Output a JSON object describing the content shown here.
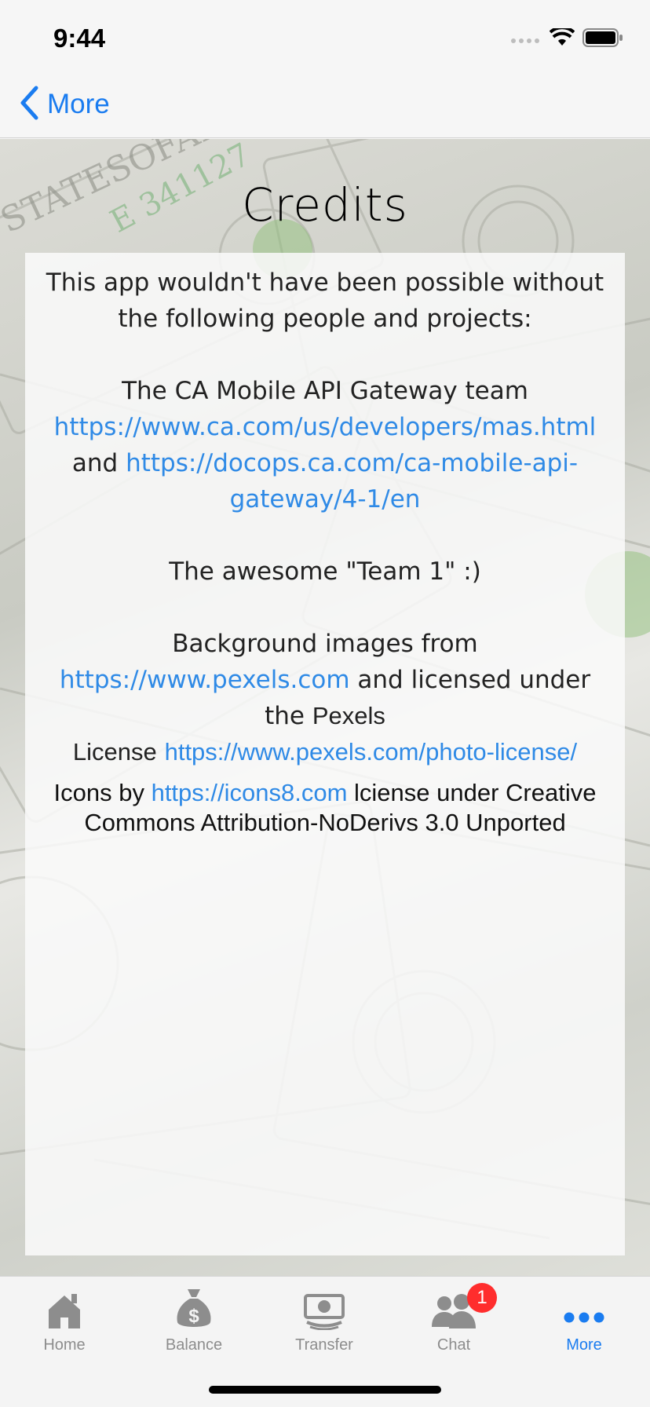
{
  "status_bar": {
    "time": "9:44"
  },
  "nav": {
    "back_label": "More"
  },
  "page": {
    "title": "Credits"
  },
  "credits": {
    "intro": "This app wouldn't have been possible without the following people and projects:",
    "gateway_prefix": "The CA Mobile API Gateway team ",
    "gateway_link1": "https://www.ca.com/us/developers/mas.html",
    "gateway_and": " and ",
    "gateway_link2": "https://docops.ca.com/ca-mobile-api-gateway/4-1/en",
    "team": "The awesome \"Team 1\" :)",
    "bg_prefix": "Background images from ",
    "bg_link": "https://www.pexels.com",
    "bg_middle": " and licensed under the ",
    "bg_pexels": "Pexels",
    "bg_license": "License",
    "bg_license_link": "https://www.pexels.com/photo-license/",
    "icons_prefix": "Icons by ",
    "icons_link": "https://icons8.com",
    "icons_suffix": " lciense under Creative Commons Attribution-NoDerivs 3.0 Unported"
  },
  "tabs": [
    {
      "label": "Home",
      "icon": "home-icon",
      "active": false
    },
    {
      "label": "Balance",
      "icon": "money-bag-icon",
      "active": false
    },
    {
      "label": "Transfer",
      "icon": "transfer-icon",
      "active": false
    },
    {
      "label": "Chat",
      "icon": "chat-icon",
      "active": false,
      "badge": "1"
    },
    {
      "label": "More",
      "icon": "more-icon",
      "active": true
    }
  ],
  "colors": {
    "accent": "#1a7cf0",
    "link": "#2f8ae6",
    "badge": "#ff2d2d",
    "inactive_tab": "#8d8d8d"
  }
}
